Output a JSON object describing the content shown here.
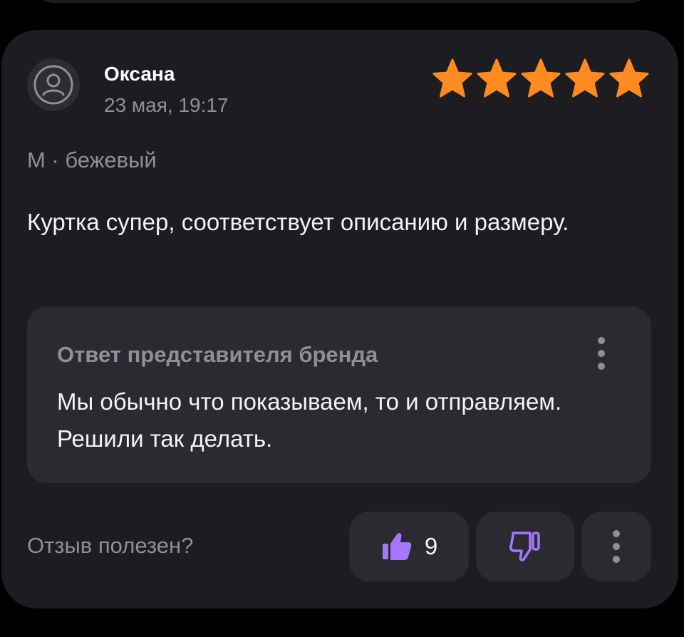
{
  "review": {
    "author": "Оксана",
    "date": "23 мая, 19:17",
    "rating": 5,
    "rating_max": 5,
    "variant": "М · бежевый",
    "text": "Куртка супер, соответствует описанию и размеру."
  },
  "brand_reply": {
    "title": "Ответ представителя бренда",
    "text": "Мы обычно что показываем, то и отправляем. Решили так делать."
  },
  "feedback": {
    "question": "Отзыв полезен?",
    "likes": "9"
  },
  "icons": {
    "avatar": "user-circle-icon",
    "star": "star-icon",
    "like": "thumbs-up-icon",
    "dislike": "thumbs-down-icon",
    "more": "more-vertical-icon"
  },
  "colors": {
    "star": "#ff8a1f",
    "accent": "#a577ff",
    "card_bg": "#1c1c21",
    "reply_bg": "#2a2a30",
    "muted_text": "#8f8f96"
  }
}
